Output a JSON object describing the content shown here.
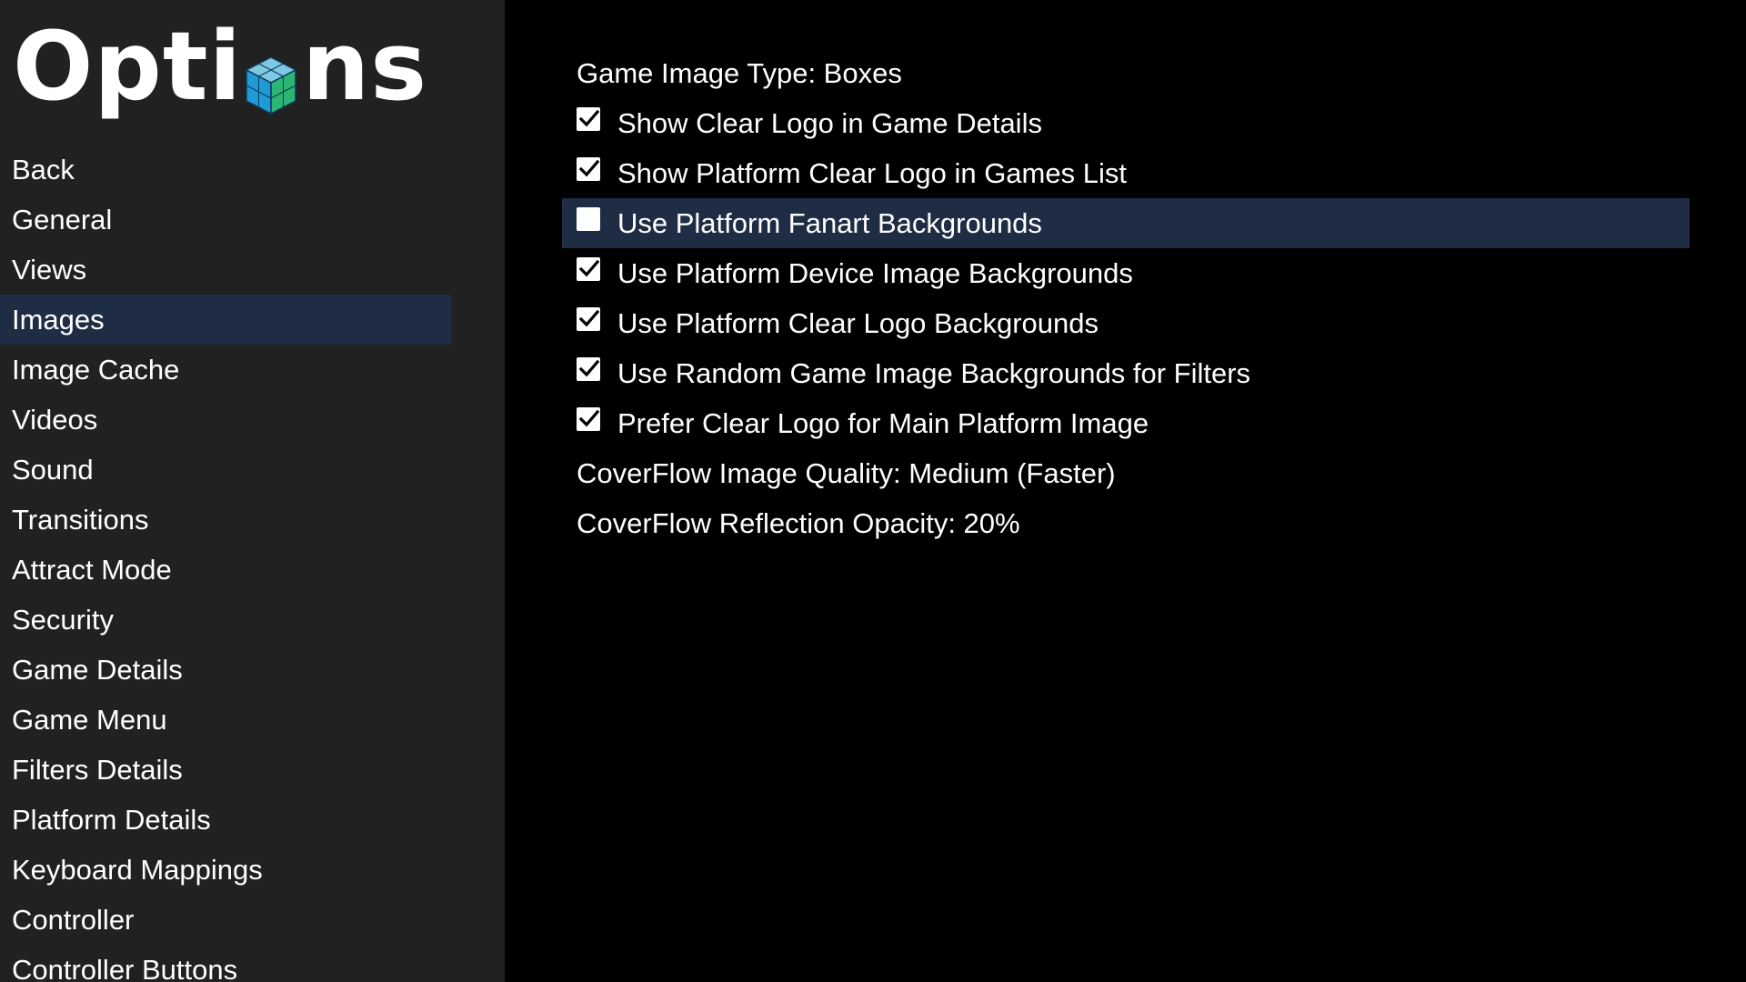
{
  "sidebar": {
    "title_prefix": "Opt",
    "title_middle": "i",
    "title_suffix": "ns",
    "items": [
      {
        "label": "Back"
      },
      {
        "label": "General"
      },
      {
        "label": "Views"
      },
      {
        "label": "Images"
      },
      {
        "label": "Image Cache"
      },
      {
        "label": "Videos"
      },
      {
        "label": "Sound"
      },
      {
        "label": "Transitions"
      },
      {
        "label": "Attract Mode"
      },
      {
        "label": "Security"
      },
      {
        "label": "Game Details"
      },
      {
        "label": "Game Menu"
      },
      {
        "label": "Filters Details"
      },
      {
        "label": "Platform Details"
      },
      {
        "label": "Keyboard Mappings"
      },
      {
        "label": "Controller"
      },
      {
        "label": "Controller Buttons"
      }
    ],
    "selected_item": "Images"
  },
  "options": [
    {
      "label": "Game Image Type: Boxes",
      "type": "value"
    },
    {
      "label": "Show Clear Logo in Game Details",
      "type": "checkbox",
      "checked": true
    },
    {
      "label": "Show Platform Clear Logo in Games List",
      "type": "checkbox",
      "checked": true
    },
    {
      "label": "Use Platform Fanart Backgrounds",
      "type": "checkbox",
      "checked": false
    },
    {
      "label": "Use Platform Device Image Backgrounds",
      "type": "checkbox",
      "checked": true
    },
    {
      "label": "Use Platform Clear Logo Backgrounds",
      "type": "checkbox",
      "checked": true
    },
    {
      "label": "Use Random Game Image Backgrounds for Filters",
      "type": "checkbox",
      "checked": true
    },
    {
      "label": "Prefer Clear Logo for Main Platform Image",
      "type": "checkbox",
      "checked": true
    },
    {
      "label": "CoverFlow Image Quality: Medium (Faster)",
      "type": "value"
    },
    {
      "label": "CoverFlow Reflection Opacity: 20%",
      "type": "value"
    }
  ],
  "selected_option": "Use Platform Fanart Backgrounds",
  "colors": {
    "sidebar_bg": "#212121",
    "main_bg": "#000000",
    "selection_bg": "#1e2d44",
    "text": "#ffffff",
    "cube_top": "#7ec8e3",
    "cube_left": "#1f9ad6",
    "cube_right": "#2bb673"
  },
  "icons": {
    "logo": "cube-icon",
    "checked": "checkbox-checked-icon",
    "unchecked": "checkbox-unchecked-icon"
  }
}
